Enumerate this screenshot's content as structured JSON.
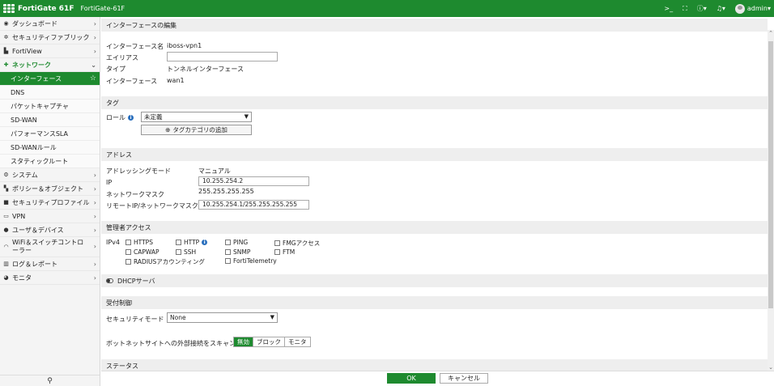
{
  "topbar": {
    "product": "FortiGate 61F",
    "hostname": "FortiGate-61F",
    "cli_icon": ">_",
    "fullscreen_icon": "[ ]",
    "help_icon": "?",
    "bell_icon": "bell",
    "user": "admin"
  },
  "sidebar": {
    "items": [
      {
        "label": "ダッシュボード",
        "icon": "dashboard"
      },
      {
        "label": "セキュリティファブリック",
        "icon": "fabric"
      },
      {
        "label": "FortiView",
        "icon": "chart"
      },
      {
        "label": "ネットワーク",
        "icon": "network"
      }
    ],
    "sub_items": [
      {
        "label": "インターフェース"
      },
      {
        "label": "DNS"
      },
      {
        "label": "パケットキャプチャ"
      },
      {
        "label": "SD-WAN"
      },
      {
        "label": "パフォーマンスSLA"
      },
      {
        "label": "SD-WANルール"
      },
      {
        "label": "スタティックルート"
      }
    ],
    "items2": [
      {
        "label": "システム",
        "icon": "gear"
      },
      {
        "label": "ポリシー＆オブジェクト",
        "icon": "policy"
      },
      {
        "label": "セキュリティプロファイル",
        "icon": "lock"
      },
      {
        "label": "VPN",
        "icon": "monitor"
      },
      {
        "label": "ユーザ＆デバイス",
        "icon": "user"
      },
      {
        "label": "WiFi＆スイッチコントローラー",
        "icon": "wifi"
      },
      {
        "label": "ログ＆レポート",
        "icon": "log"
      },
      {
        "label": "モニタ",
        "icon": "pie"
      }
    ]
  },
  "edit": {
    "section_title": "インターフェースの編集",
    "name_label": "インターフェース名",
    "name_value": "iboss-vpn1",
    "alias_label": "エイリアス",
    "alias_value": "",
    "type_label": "タイプ",
    "type_value": "トンネルインターフェース",
    "iface_label": "インターフェース",
    "iface_value": "wan1"
  },
  "tag": {
    "section_title": "タグ",
    "role_label": "ロール",
    "role_value": "未定義",
    "add_category": "タグカテゴリの追加"
  },
  "address": {
    "section_title": "アドレス",
    "mode_label": "アドレッシングモード",
    "mode_value": "マニュアル",
    "ip_label": "IP",
    "ip_value": "10.255.254.2",
    "mask_label": "ネットワークマスク",
    "mask_value": "255.255.255.255",
    "remote_label": "リモートIP/ネットワークマスク",
    "remote_value": "10.255.254.1/255.255.255.255"
  },
  "admin_access": {
    "section_title": "管理者アクセス",
    "ipv4_label": "IPv4",
    "options": [
      "HTTPS",
      "HTTP",
      "PING",
      "FMGアクセス",
      "CAPWAP",
      "SSH",
      "SNMP",
      "FTM",
      "RADIUSアカウンティング",
      "FortiTelemetry"
    ]
  },
  "dhcp": {
    "label": "DHCPサーバ"
  },
  "admission": {
    "section_title": "受付制御",
    "security_mode_label": "セキュリティモード",
    "security_mode_value": "None"
  },
  "botnet": {
    "label": "ボットネットサイトへの外部接続をスキャン",
    "options": [
      "無効",
      "ブロック",
      "モニタ"
    ]
  },
  "status": {
    "section_title": "ステータス"
  },
  "footer": {
    "ok": "OK",
    "cancel": "キャンセル"
  },
  "colors": {
    "brand": "#1e8a2f"
  }
}
